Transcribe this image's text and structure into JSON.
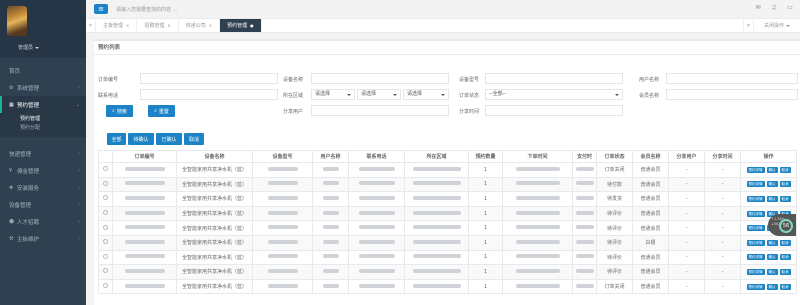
{
  "sidebar": {
    "role": "管理员",
    "items": [
      {
        "label": "首页",
        "icon": "home-icon",
        "arrow": ""
      },
      {
        "label": "系统管理",
        "icon": "gear-icon",
        "arrow": "‹"
      },
      {
        "label": "预约管理",
        "icon": "calendar-icon",
        "arrow": "⌄"
      }
    ],
    "sub": [
      "预约管理",
      "预约分配"
    ],
    "items2": [
      {
        "label": "快递管理",
        "icon": "",
        "arrow": "‹"
      },
      {
        "label": "佣金管理",
        "icon": "money-icon",
        "arrow": "‹"
      },
      {
        "label": "安装服务",
        "icon": "tool-icon",
        "arrow": "‹"
      },
      {
        "label": "设备管理",
        "icon": "",
        "arrow": "‹"
      },
      {
        "label": "人才招聘",
        "icon": "people-icon",
        "arrow": "‹"
      },
      {
        "label": "主板维护",
        "icon": "board-icon",
        "arrow": "‹"
      }
    ]
  },
  "topbar": {
    "search_placeholder": "请输入您需要查找的内容 …"
  },
  "tabs": [
    {
      "label": "主板管理",
      "active": false
    },
    {
      "label": "招聘管理",
      "active": false
    },
    {
      "label": "快递公司",
      "active": false
    },
    {
      "label": "预约管理",
      "active": true
    }
  ],
  "tab_ops": "关闭操作",
  "panel_title": "预约列表",
  "form": {
    "order_no": "订单编号",
    "device_name": "设备名称",
    "device_model": "设备型号",
    "username": "用户名称",
    "phone": "联系电话",
    "region": "所在区域",
    "region_select": [
      "请选择",
      "请选择",
      "请选择"
    ],
    "order_status": "订单状态",
    "order_status_value": "--全部--",
    "member_name": "会员名称",
    "share_user": "分享用户",
    "share_time": "分享时间",
    "search_btn": "搜索",
    "reset_btn": "重置"
  },
  "filters": [
    "全部",
    "待确认",
    "已确认",
    "取消"
  ],
  "table": {
    "headers": [
      "",
      "订单编号",
      "设备名称",
      "设备型号",
      "用户名称",
      "联系电话",
      "所在区域",
      "预约数量",
      "下单时间",
      "支付时",
      "订单状态",
      "会员名称",
      "分享用户",
      "分享时间",
      "操作"
    ],
    "rows": [
      {
        "device": "全智能家用共享净水机（蓝）",
        "qty": "1",
        "status": "订单关闭",
        "member": "普通会员",
        "share": "-",
        "stime": "-"
      },
      {
        "device": "全智能家用共享净水机（蓝）",
        "qty": "1",
        "status": "待付款",
        "member": "普通会员",
        "share": "-",
        "stime": "-"
      },
      {
        "device": "全智能家用共享净水机（蓝）",
        "qty": "1",
        "status": "待发货",
        "member": "普通会员",
        "share": "-",
        "stime": "-"
      },
      {
        "device": "全智能家用共享净水机（蓝）",
        "qty": "1",
        "status": "待评价",
        "member": "普通会员",
        "share": "-",
        "stime": "-"
      },
      {
        "device": "全智能家用共享净水机（蓝）",
        "qty": "1",
        "status": "待评价",
        "member": "普通会员",
        "share": "-",
        "stime": "-"
      },
      {
        "device": "全智能家用共享净水机（蓝）",
        "qty": "1",
        "status": "待评价",
        "member": "白银",
        "share": "-",
        "stime": "-"
      },
      {
        "device": "全智能家用共享净水机（蓝）",
        "qty": "1",
        "status": "待评价",
        "member": "普通会员",
        "share": "-",
        "stime": "-"
      },
      {
        "device": "全智能家用共享净水机（蓝）",
        "qty": "1",
        "status": "待评价",
        "member": "普通会员",
        "share": "-",
        "stime": "-"
      },
      {
        "device": "全智能家用共享净水机（蓝）",
        "qty": "1",
        "status": "订单关闭",
        "member": "普通会员",
        "share": "-",
        "stime": "-"
      }
    ],
    "ops": [
      "预约详情",
      "确认",
      "取消"
    ]
  },
  "widget": {
    "pct": "56",
    "up": "1.3K/s",
    "down": "0K/s"
  }
}
